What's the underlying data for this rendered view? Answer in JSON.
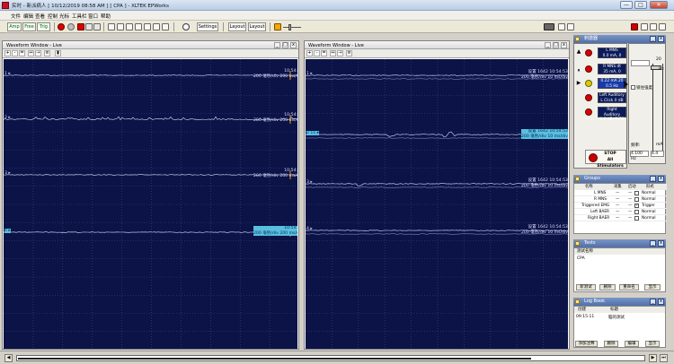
{
  "window": {
    "title": "实时 - 新派病人 [ 10/12/2019 08:58 AM ] [ CPA ] - XLTEK EPWorks",
    "min": "—",
    "max": "□",
    "close": "✕"
  },
  "menu": [
    "文件",
    "编辑",
    "查看",
    "控制",
    "光标",
    "工具栏",
    "窗口",
    "帮助"
  ],
  "toolbar": {
    "amp": "Amp",
    "free": "Free",
    "trig": "Trig",
    "settings": "Settings",
    "layout1": "Layout",
    "layout2": "Layout"
  },
  "left_window": {
    "title": "Waveform Window - Live",
    "channels": [
      {
        "label": "1",
        "time": "10:54:53",
        "scale": "200 毫秒/div 200 ms/div",
        "selected": false
      },
      {
        "label": "2",
        "time": "10:54:53",
        "scale": "200 毫秒/div 200 ms/div",
        "selected": false
      },
      {
        "label": "3",
        "time": "10:54:53",
        "scale": "200 毫秒/div 200 ms/div",
        "selected": false
      },
      {
        "label": "4",
        "time": "10:54:53",
        "scale": "200 毫秒/div 200 ms/div",
        "selected": true
      }
    ]
  },
  "right_window": {
    "title": "Waveform Window - Live",
    "channels": [
      {
        "label": "1",
        "l1": "设置 1642 10:54:53",
        "l2": "200 毫秒/div 10 ms/div",
        "selected": false
      },
      {
        "label": "2 11",
        "l1": "设置 1642 10:54:53",
        "l2": "200 毫秒/div 10 ms/div",
        "selected": true
      },
      {
        "label": "3",
        "l1": "设置 1642 10:54:53",
        "l2": "200 毫秒/div 10 ms/div",
        "selected": false
      },
      {
        "label": "4",
        "l1": "设置 1642 10:54:53",
        "l2": "200 毫秒/div 10 ms/div",
        "selected": false
      }
    ]
  },
  "stimulators": {
    "title": "刺激器",
    "items": [
      {
        "name": "L MNS",
        "value": "0.0 mA, 0"
      },
      {
        "name": "R MNS  dt",
        "value": "35 mA, 0"
      },
      {
        "name": "0.22 mA 20",
        "value": "0.5 Hz"
      },
      {
        "name": "Left Auditory",
        "value": "L Click 0 dB"
      },
      {
        "name": "Right Auditory",
        "value": "L 0 dB, R Cli"
      }
    ],
    "stop_top": "STOP",
    "stop_bottom": "All Stimulators",
    "freq_label": "频率:",
    "freq_value": "4.100 Hz",
    "freq_right": "4.4",
    "ma": "mA",
    "hz_top": "20",
    "hz_unit": "Hz",
    "check_label": "锁住强度"
  },
  "groups": {
    "title": "Groups",
    "headers": [
      "名称",
      "采集",
      "启动",
      "形式"
    ],
    "rows": [
      {
        "name": "L MNS",
        "c1": "—",
        "c2": "—",
        "checked": false,
        "mode": "Normal"
      },
      {
        "name": "R MNS",
        "c1": "—",
        "c2": "—",
        "checked": false,
        "mode": "Normal"
      },
      {
        "name": "Triggered EMG",
        "c1": "—",
        "c2": "—",
        "checked": true,
        "mode": "Trigger"
      },
      {
        "name": "Left BAER",
        "c1": "—",
        "c2": "—",
        "checked": false,
        "mode": "Normal"
      },
      {
        "name": "Right BAER",
        "c1": "—",
        "c2": "—",
        "checked": false,
        "mode": "Normal"
      }
    ]
  },
  "tests": {
    "title": "Tests",
    "header": "测试名称",
    "item": "CPA",
    "buttons": [
      "新测试",
      "删除",
      "重命名",
      "显示"
    ]
  },
  "log": {
    "title": "Log Book",
    "headers": [
      "创建",
      "标题"
    ],
    "entry_time": "09:15:11",
    "entry_text": "脑的测试",
    "buttons": [
      "添加注释",
      "删除",
      "编辑",
      "显示"
    ]
  },
  "colors": {
    "wave_bg": "#0b1347",
    "trace": "#dfe3ff",
    "selected": "#59bfe0",
    "stim_red": "#d40000"
  },
  "transport": {
    "progress_fraction": 0.82
  }
}
